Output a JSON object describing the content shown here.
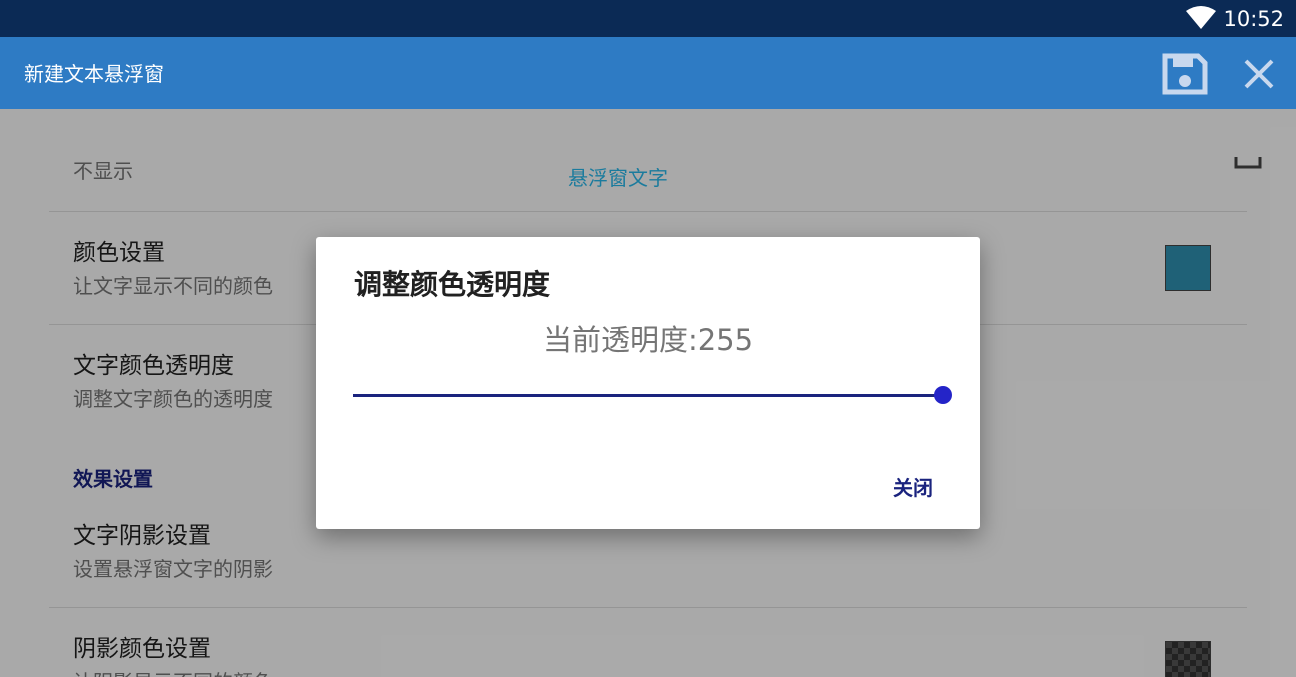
{
  "status_bar": {
    "time": "10:52",
    "wifi_icon": "wifi-icon"
  },
  "app_bar": {
    "title": "新建文本悬浮窗",
    "save_icon": "save-icon",
    "close_icon": "close-icon"
  },
  "list": {
    "display_row": {
      "label": "不显示",
      "preview_text": "悬浮窗文字"
    },
    "color_setting": {
      "title": "颜色设置",
      "subtitle": "让文字显示不同的颜色",
      "swatch_color": "#2f8fb0"
    },
    "text_alpha": {
      "title": "文字颜色透明度",
      "subtitle": "调整文字颜色的透明度"
    },
    "section_effects": "效果设置",
    "shadow_setting": {
      "title": "文字阴影设置",
      "subtitle": "设置悬浮窗文字的阴影"
    },
    "shadow_color": {
      "title": "阴影颜色设置",
      "subtitle": "让阴影显示不同的颜色"
    }
  },
  "dialog": {
    "title": "调整颜色透明度",
    "value_text": "当前透明度:255",
    "slider_value": 255,
    "slider_max": 255,
    "close_button": "关闭"
  },
  "colors": {
    "status_bar": "#0b2a55",
    "app_bar": "#2e7bc4",
    "accent": "#1a237e",
    "slider_thumb": "#2424c8"
  }
}
